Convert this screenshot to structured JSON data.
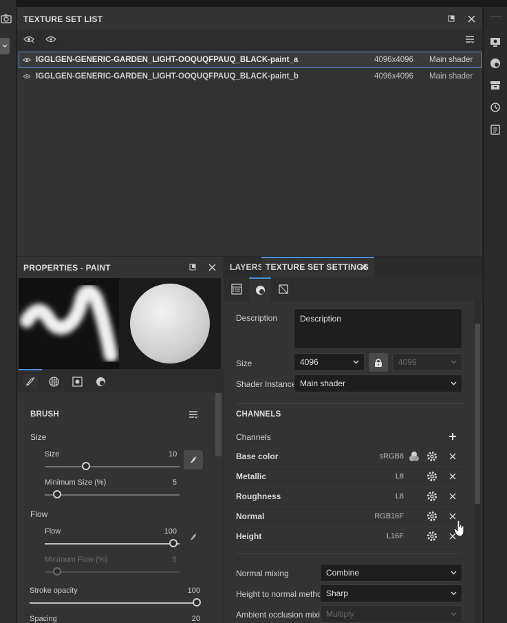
{
  "texture_set_list": {
    "title": "TEXTURE SET LIST",
    "items": [
      {
        "name": "IGGLGEN-GENERIC-GARDEN_LIGHT-OOQUQFPAUQ_BLACK-paint_a",
        "resolution": "4096x4096",
        "shader": "Main shader"
      },
      {
        "name": "IGGLGEN-GENERIC-GARDEN_LIGHT-OOQUQFPAUQ_BLACK-paint_b",
        "resolution": "4096x4096",
        "shader": "Main shader"
      }
    ]
  },
  "properties": {
    "title": "PROPERTIES - PAINT",
    "brush_title": "BRUSH",
    "size_group": "Size",
    "size_label": "Size",
    "size_value": "10",
    "size_fraction": 0.3,
    "min_size_label": "Minimum Size (%)",
    "min_size_value": "5",
    "min_size_fraction": 0.05,
    "flow_group": "Flow",
    "flow_label": "Flow",
    "flow_value": "100",
    "flow_fraction": 1.0,
    "min_flow_label": "Minimum Flow (%)",
    "min_flow_value": "5",
    "stroke_opacity_label": "Stroke opacity",
    "stroke_opacity_value": "100",
    "spacing_label": "Spacing",
    "spacing_value": "20"
  },
  "tabs": {
    "layers": "LAYERS",
    "texture_set_settings": "TEXTURE SET SETTINGS"
  },
  "settings": {
    "description_label": "Description",
    "description_value": "Description",
    "size_label": "Size",
    "size_value": "4096",
    "size_linked_value": "4096",
    "shader_label": "Shader Instance",
    "shader_value": "Main shader",
    "channels_title": "CHANNELS",
    "channels_label": "Channels",
    "channels": [
      {
        "name": "Base color",
        "format": "sRGB8"
      },
      {
        "name": "Metallic",
        "format": "L8"
      },
      {
        "name": "Roughness",
        "format": "L8"
      },
      {
        "name": "Normal",
        "format": "RGB16F"
      },
      {
        "name": "Height",
        "format": "L16F"
      }
    ],
    "normal_mixing_label": "Normal mixing",
    "normal_mixing_value": "Combine",
    "height_to_normal_label": "Height to normal method",
    "height_to_normal_value": "Sharp",
    "ao_mixing_label": "Ambient occlusion mixing",
    "ao_mixing_value": "Multiply"
  },
  "colors": {
    "accent": "#4a8fd9",
    "panel": "#333333",
    "background": "#262626"
  }
}
